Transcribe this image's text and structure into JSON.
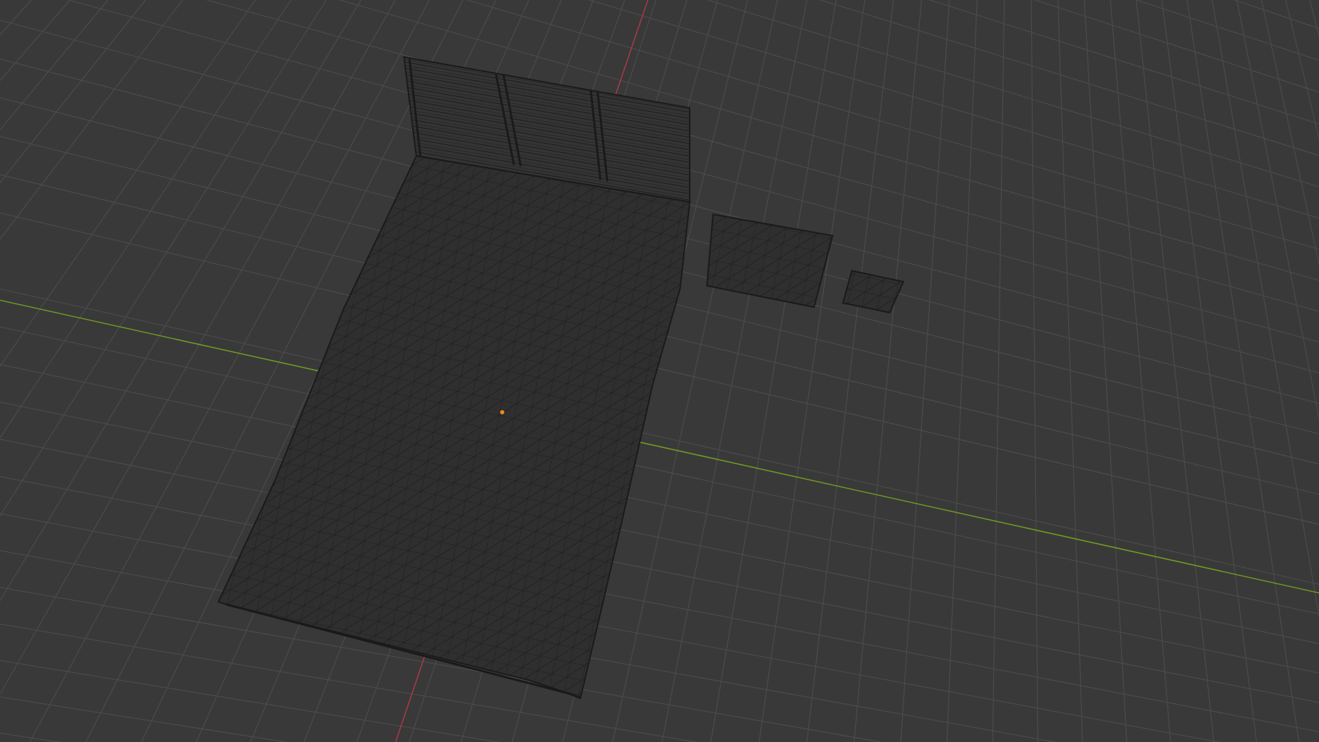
{
  "viewport": {
    "objects": [
      {
        "kind": "bed"
      },
      {
        "kind": "pillow"
      },
      {
        "kind": "pillow"
      }
    ]
  }
}
